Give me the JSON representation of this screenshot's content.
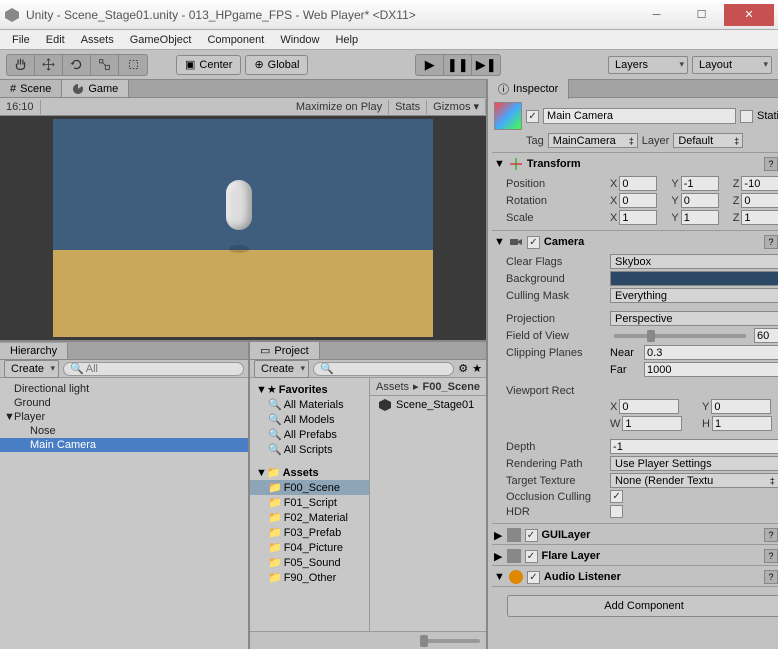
{
  "window": {
    "title": "Unity - Scene_Stage01.unity - 013_HPgame_FPS - Web Player* <DX11>"
  },
  "menu": [
    "File",
    "Edit",
    "Assets",
    "GameObject",
    "Component",
    "Window",
    "Help"
  ],
  "toolbar": {
    "center": "Center",
    "global": "Global",
    "layers": "Layers",
    "layout": "Layout"
  },
  "scene": {
    "tab_scene": "Scene",
    "tab_game": "Game",
    "aspect": "16:10",
    "maximize": "Maximize on Play",
    "stats": "Stats",
    "gizmos": "Gizmos"
  },
  "hierarchy": {
    "title": "Hierarchy",
    "create": "Create",
    "search_placeholder": "All",
    "items": [
      {
        "name": "Directional light",
        "depth": 0
      },
      {
        "name": "Ground",
        "depth": 0
      },
      {
        "name": "Player",
        "depth": 0,
        "expanded": true
      },
      {
        "name": "Nose",
        "depth": 1
      },
      {
        "name": "Main Camera",
        "depth": 1,
        "selected": true
      }
    ]
  },
  "project": {
    "title": "Project",
    "create": "Create",
    "favorites": "Favorites",
    "fav_items": [
      "All Materials",
      "All Models",
      "All Prefabs",
      "All Scripts"
    ],
    "assets": "Assets",
    "folders": [
      "F00_Scene",
      "F01_Script",
      "F02_Material",
      "F03_Prefab",
      "F04_Picture",
      "F05_Sound",
      "F90_Other"
    ],
    "selected_folder": "F00_Scene",
    "breadcrumb_root": "Assets",
    "breadcrumb_cur": "F00_Scene",
    "item": "Scene_Stage01"
  },
  "inspector": {
    "title": "Inspector",
    "name": "Main Camera",
    "static": "Static",
    "tag_label": "Tag",
    "tag": "MainCamera",
    "layer_label": "Layer",
    "layer": "Default",
    "transform": {
      "title": "Transform",
      "position": "Position",
      "px": "0",
      "py": "-1",
      "pz": "-10",
      "rotation": "Rotation",
      "rx": "0",
      "ry": "0",
      "rz": "0",
      "scale": "Scale",
      "sx": "1",
      "sy": "1",
      "sz": "1"
    },
    "camera": {
      "title": "Camera",
      "clear_flags": "Clear Flags",
      "clear_flags_v": "Skybox",
      "background": "Background",
      "culling": "Culling Mask",
      "culling_v": "Everything",
      "projection": "Projection",
      "projection_v": "Perspective",
      "fov": "Field of View",
      "fov_v": "60",
      "clip": "Clipping Planes",
      "near_l": "Near",
      "near_v": "0.3",
      "far_l": "Far",
      "far_v": "1000",
      "viewport": "Viewport Rect",
      "vx": "0",
      "vy": "0",
      "vw": "1",
      "vh": "1",
      "depth": "Depth",
      "depth_v": "-1",
      "render_path": "Rendering Path",
      "render_path_v": "Use Player Settings",
      "target_tex": "Target Texture",
      "target_tex_v": "None (Render Textu",
      "occlusion": "Occlusion Culling",
      "hdr": "HDR"
    },
    "guilayer": "GUILayer",
    "flare": "Flare Layer",
    "audio": "Audio Listener",
    "add_component": "Add Component"
  }
}
